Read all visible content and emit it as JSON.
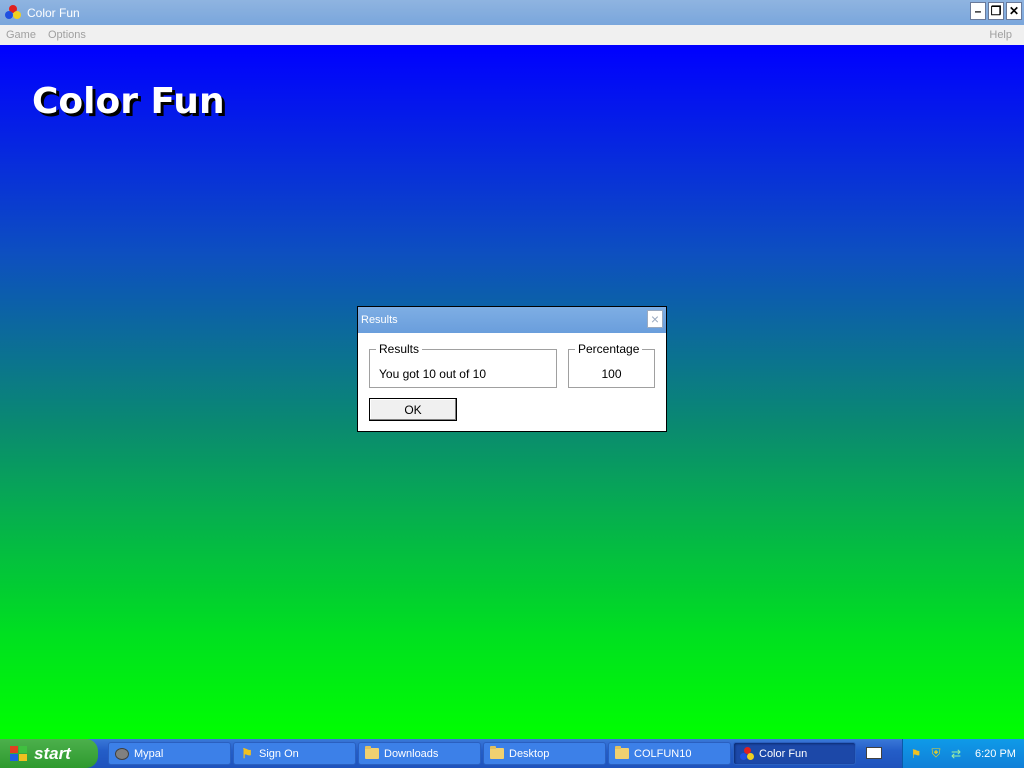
{
  "window": {
    "title": "Color Fun",
    "controls": {
      "minimize": "–",
      "restore": "❐",
      "close": "✕"
    }
  },
  "menubar": {
    "items": [
      "Game",
      "Options"
    ],
    "help": "Help"
  },
  "canvas": {
    "title": "Color Fun"
  },
  "dialog": {
    "title": "Results",
    "close": "×",
    "results_label": "Results",
    "results_value": "You got 10 out of 10",
    "percentage_label": "Percentage",
    "percentage_value": "100",
    "ok_label": "OK"
  },
  "taskbar": {
    "start_label": "start",
    "tasks": [
      {
        "label": "Mypal",
        "icon": "mypal-icon"
      },
      {
        "label": "Sign On",
        "icon": "runner-icon"
      },
      {
        "label": "Downloads",
        "icon": "folder-icon"
      },
      {
        "label": "Desktop",
        "icon": "folder-icon"
      },
      {
        "label": "COLFUN10",
        "icon": "folder-icon"
      },
      {
        "label": "Color Fun",
        "icon": "color-fun-icon",
        "active": true
      }
    ],
    "clock": "6:20 PM"
  },
  "colors": {
    "gradient_top": "#0000ff",
    "gradient_bottom": "#00ff00",
    "titlebar": "#7aa6dc",
    "taskbar": "#245ec8"
  }
}
